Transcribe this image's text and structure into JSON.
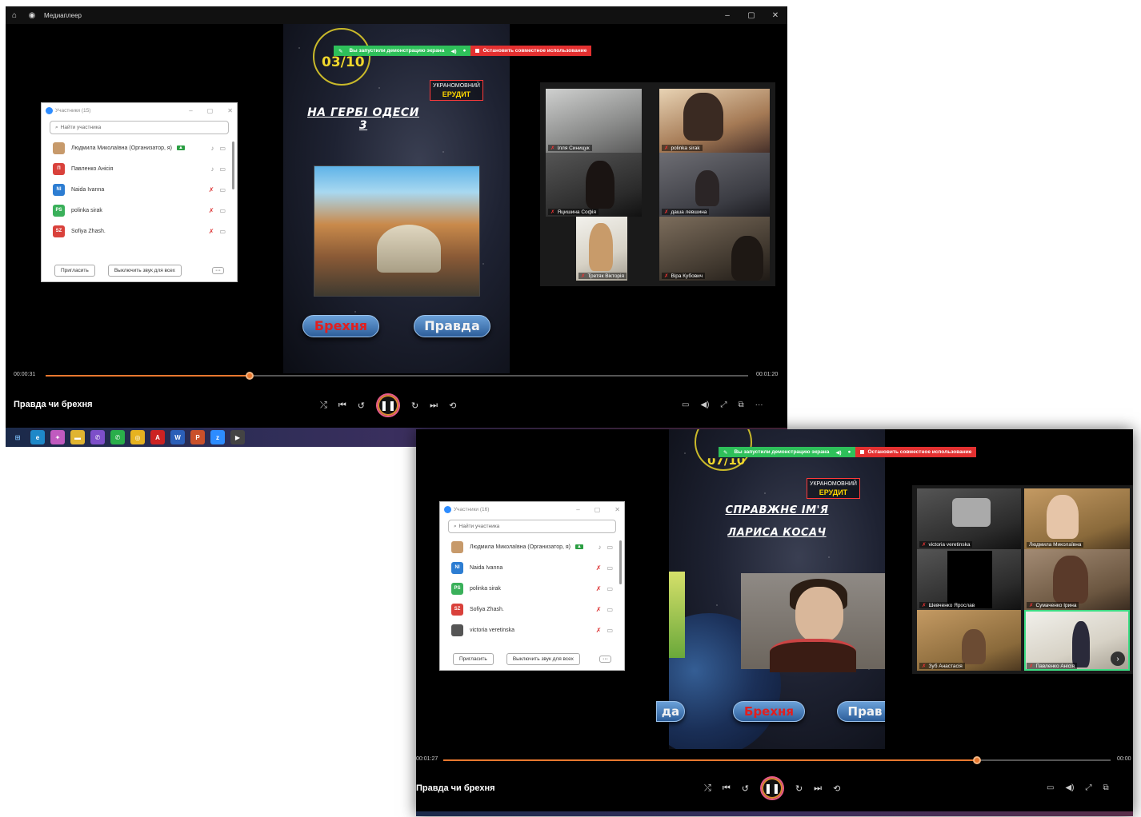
{
  "screenshot1": {
    "window": {
      "app_title": "Медиаплеер",
      "controls": [
        "–",
        "▢",
        "✕"
      ]
    },
    "slide": {
      "counter": "03/10",
      "brand_line1": "УКРАНОМОВНИЙ",
      "brand_line2": "ЕРУДИТ",
      "question": "НА ГЕРБІ ОДЕСИ 3",
      "answer_left": "Брехня",
      "answer_right": "Правда"
    },
    "share_banner": {
      "started_text": "Вы запустили демонстрацию экрана",
      "stop_text": "Остановить совместное использование"
    },
    "participants_panel": {
      "title": "Участники (15)",
      "search_placeholder": "Найти участника",
      "participants": [
        {
          "initials": "",
          "name": "Людмила Миколаївна (Организатор, я)",
          "color": "#c79a6b",
          "host": true,
          "muted": false
        },
        {
          "initials": "П",
          "name": "Павленко Анісія",
          "color": "#d9413b",
          "host": false,
          "muted": false
        },
        {
          "initials": "NI",
          "name": "Naida Ivanna",
          "color": "#2d7dd2",
          "host": false,
          "muted": true
        },
        {
          "initials": "PS",
          "name": "polinka sirak",
          "color": "#3ab05a",
          "host": false,
          "muted": true
        },
        {
          "initials": "SZ",
          "name": "Sofiya Zhash.",
          "color": "#d9413b",
          "host": false,
          "muted": true
        }
      ],
      "invite_label": "Пригласить",
      "mute_all_label": "Выключить звук для всех",
      "more_label": "···"
    },
    "gallery": [
      {
        "name": "Ілля Синицук"
      },
      {
        "name": "polinka sirak"
      },
      {
        "name": "Яцишина Софія"
      },
      {
        "name": "даша левшина"
      },
      {
        "name": "Третяк Вікторія"
      },
      {
        "name": "Віра Кубович"
      }
    ],
    "player": {
      "time_current": "00:00:31",
      "time_total": "00:01:20",
      "progress": 0.29,
      "media_title": "Правда чи брехня"
    }
  },
  "screenshot2": {
    "slide": {
      "counter": "07/10",
      "brand_line1": "УКРАНОМОВНИЙ",
      "brand_line2": "ЕРУДИТ",
      "question_line1": "СПРАВЖНЄ ІМ'Я",
      "question_line2": "ЛАРИСА КОСАЧ",
      "answer_left": "Брехня",
      "answer_right": "Прав",
      "prev_answer": "да"
    },
    "share_banner": {
      "started_text": "Вы запустили демонстрацию экрана",
      "stop_text": "Остановить совместное использование"
    },
    "participants_panel": {
      "title": "Участники (16)",
      "search_placeholder": "Найти участника",
      "participants": [
        {
          "initials": "",
          "name": "Людмила Миколаївна (Организатор, я)",
          "color": "#c79a6b",
          "host": true,
          "muted": false
        },
        {
          "initials": "NI",
          "name": "Naida Ivanna",
          "color": "#2d7dd2",
          "host": false,
          "muted": true
        },
        {
          "initials": "PS",
          "name": "polinka sirak",
          "color": "#3ab05a",
          "host": false,
          "muted": true
        },
        {
          "initials": "SZ",
          "name": "Sofiya Zhash.",
          "color": "#d9413b",
          "host": false,
          "muted": true
        },
        {
          "initials": "",
          "name": "victoria veretinska",
          "color": "#555555",
          "host": false,
          "muted": true
        }
      ],
      "invite_label": "Пригласить",
      "mute_all_label": "Выключить звук для всех",
      "more_label": "···"
    },
    "gallery": [
      {
        "name": "victoria veretinska"
      },
      {
        "name": "Людмила Миколаївна"
      },
      {
        "name": "Шевченко Ярослав"
      },
      {
        "name": "Сумаченко Ірина"
      },
      {
        "name": "Зуб Анастасія"
      },
      {
        "name": "Павленко Анісія"
      }
    ],
    "player": {
      "time_current": "00:01:27",
      "time_total": "00:00",
      "progress": 0.8,
      "media_title": "Правда чи брехня"
    }
  },
  "colors": {
    "accent_orange": "#e8782f",
    "share_green": "#2ec05a",
    "share_red": "#e33030",
    "counter_yellow": "#f0d72c"
  }
}
